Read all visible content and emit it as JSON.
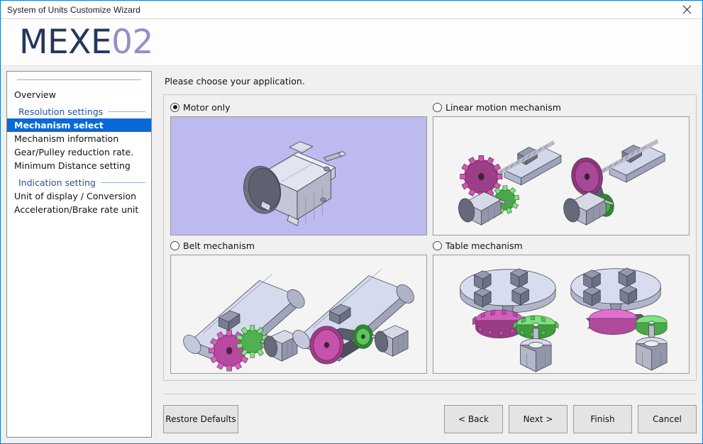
{
  "window": {
    "title": "System of Units Customize Wizard",
    "close_label": "✕",
    "border_color": "#0a7ad0"
  },
  "logo": {
    "text_primary": "MEXE",
    "text_secondary": "02",
    "color_primary": "#24375c",
    "color_secondary": "#9a8cc4"
  },
  "sidebar": {
    "items": [
      {
        "label": "Overview",
        "type": "item",
        "selected": false
      },
      {
        "label": "Resolution settings",
        "type": "group"
      },
      {
        "label": "Mechanism select",
        "type": "item",
        "selected": true
      },
      {
        "label": "Mechanism information",
        "type": "item",
        "selected": false
      },
      {
        "label": "Gear/Pulley reduction rate.",
        "type": "item",
        "selected": false
      },
      {
        "label": "Minimum Distance setting",
        "type": "item",
        "selected": false
      },
      {
        "label": "Indication setting",
        "type": "group"
      },
      {
        "label": "Unit of display / Conversion",
        "type": "item",
        "selected": false
      },
      {
        "label": "Acceleration/Brake rate unit",
        "type": "item",
        "selected": false
      }
    ],
    "selected_bg": "#0a69d8",
    "group_color": "#2b4fa0"
  },
  "main": {
    "prompt": "Please choose your application.",
    "options": [
      {
        "id": "motor-only",
        "label": "Motor only",
        "selected": true
      },
      {
        "id": "linear-motion-mechanism",
        "label": "Linear motion mechanism",
        "selected": false
      },
      {
        "id": "belt-mechanism",
        "label": "Belt mechanism",
        "selected": false
      },
      {
        "id": "table-mechanism",
        "label": "Table mechanism",
        "selected": false
      }
    ],
    "selected_thumb_bg": "#bdbaf0"
  },
  "footer": {
    "restore_label": "Restore Defaults",
    "back_label": "< Back",
    "next_label": "Next >",
    "finish_label": "Finish",
    "cancel_label": "Cancel"
  }
}
